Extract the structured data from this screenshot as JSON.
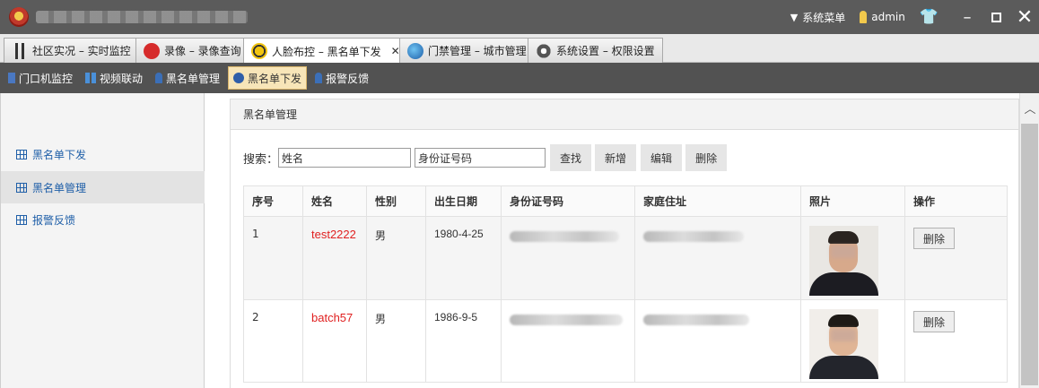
{
  "titlebar": {
    "menu_label": "系统菜单",
    "user": "admin"
  },
  "tabs": [
    {
      "label": "社区实况 – 实时监控",
      "active": false
    },
    {
      "label": "录像 – 录像查询",
      "active": false
    },
    {
      "label": "人脸布控 – 黑名单下发",
      "active": true
    },
    {
      "label": "门禁管理 – 城市管理",
      "active": false
    },
    {
      "label": "系统设置 – 权限设置",
      "active": false
    }
  ],
  "subnav": [
    {
      "label": "门口机监控"
    },
    {
      "label": "视频联动"
    },
    {
      "label": "黑名单管理"
    },
    {
      "label": "黑名单下发",
      "active": true
    },
    {
      "label": "报警反馈"
    }
  ],
  "sidebar": {
    "items": [
      {
        "label": "黑名单下发"
      },
      {
        "label": "黑名单管理",
        "active": true
      },
      {
        "label": "报警反馈"
      }
    ]
  },
  "panel": {
    "title": "黑名单管理"
  },
  "search": {
    "label": "搜索：",
    "name_value": "姓名",
    "id_value": "身份证号码",
    "buttons": {
      "find": "查找",
      "add": "新增",
      "edit": "编辑",
      "delete": "删除"
    }
  },
  "table": {
    "headers": [
      "序号",
      "姓名",
      "性别",
      "出生日期",
      "身份证号码",
      "家庭住址",
      "照片",
      "操作"
    ],
    "rows": [
      {
        "no": "1",
        "name": "test2222",
        "gender": "男",
        "dob": "1980-4-25",
        "action": "删除"
      },
      {
        "no": "2",
        "name": "batch57",
        "gender": "男",
        "dob": "1986-9-5",
        "action": "删除"
      }
    ]
  },
  "colors": {
    "titlebar": "#5b5b5b",
    "accent_link": "#1f5fa8",
    "name_red": "#e02020",
    "active_subnav": "#f7e5b8"
  }
}
